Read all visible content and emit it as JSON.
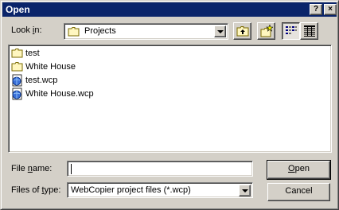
{
  "window": {
    "title": "Open",
    "help_button": "?",
    "close_button": "×"
  },
  "lookin": {
    "label_accel": "Look ",
    "label_key": "i",
    "label_rest": "n:",
    "value": "Projects",
    "icon": "folder-icon"
  },
  "toolbar": {
    "up_icon": "up-folder-icon",
    "newfolder_icon": "new-folder-icon",
    "list_icon": "list-view-icon",
    "details_icon": "details-view-icon"
  },
  "files": [
    {
      "name": "test",
      "icon": "folder-icon"
    },
    {
      "name": "White House",
      "icon": "folder-icon"
    },
    {
      "name": "test.wcp",
      "icon": "webcopier-file-icon"
    },
    {
      "name": "White House.wcp",
      "icon": "webcopier-file-icon"
    }
  ],
  "filename": {
    "label_pre": "File ",
    "label_key": "n",
    "label_rest": "ame:",
    "value": ""
  },
  "filetype": {
    "label_pre": "Files of ",
    "label_key": "t",
    "label_rest": "ype:",
    "value": "WebCopier project files (*.wcp)"
  },
  "buttons": {
    "open_key": "O",
    "open_rest": "pen",
    "cancel": "Cancel"
  }
}
